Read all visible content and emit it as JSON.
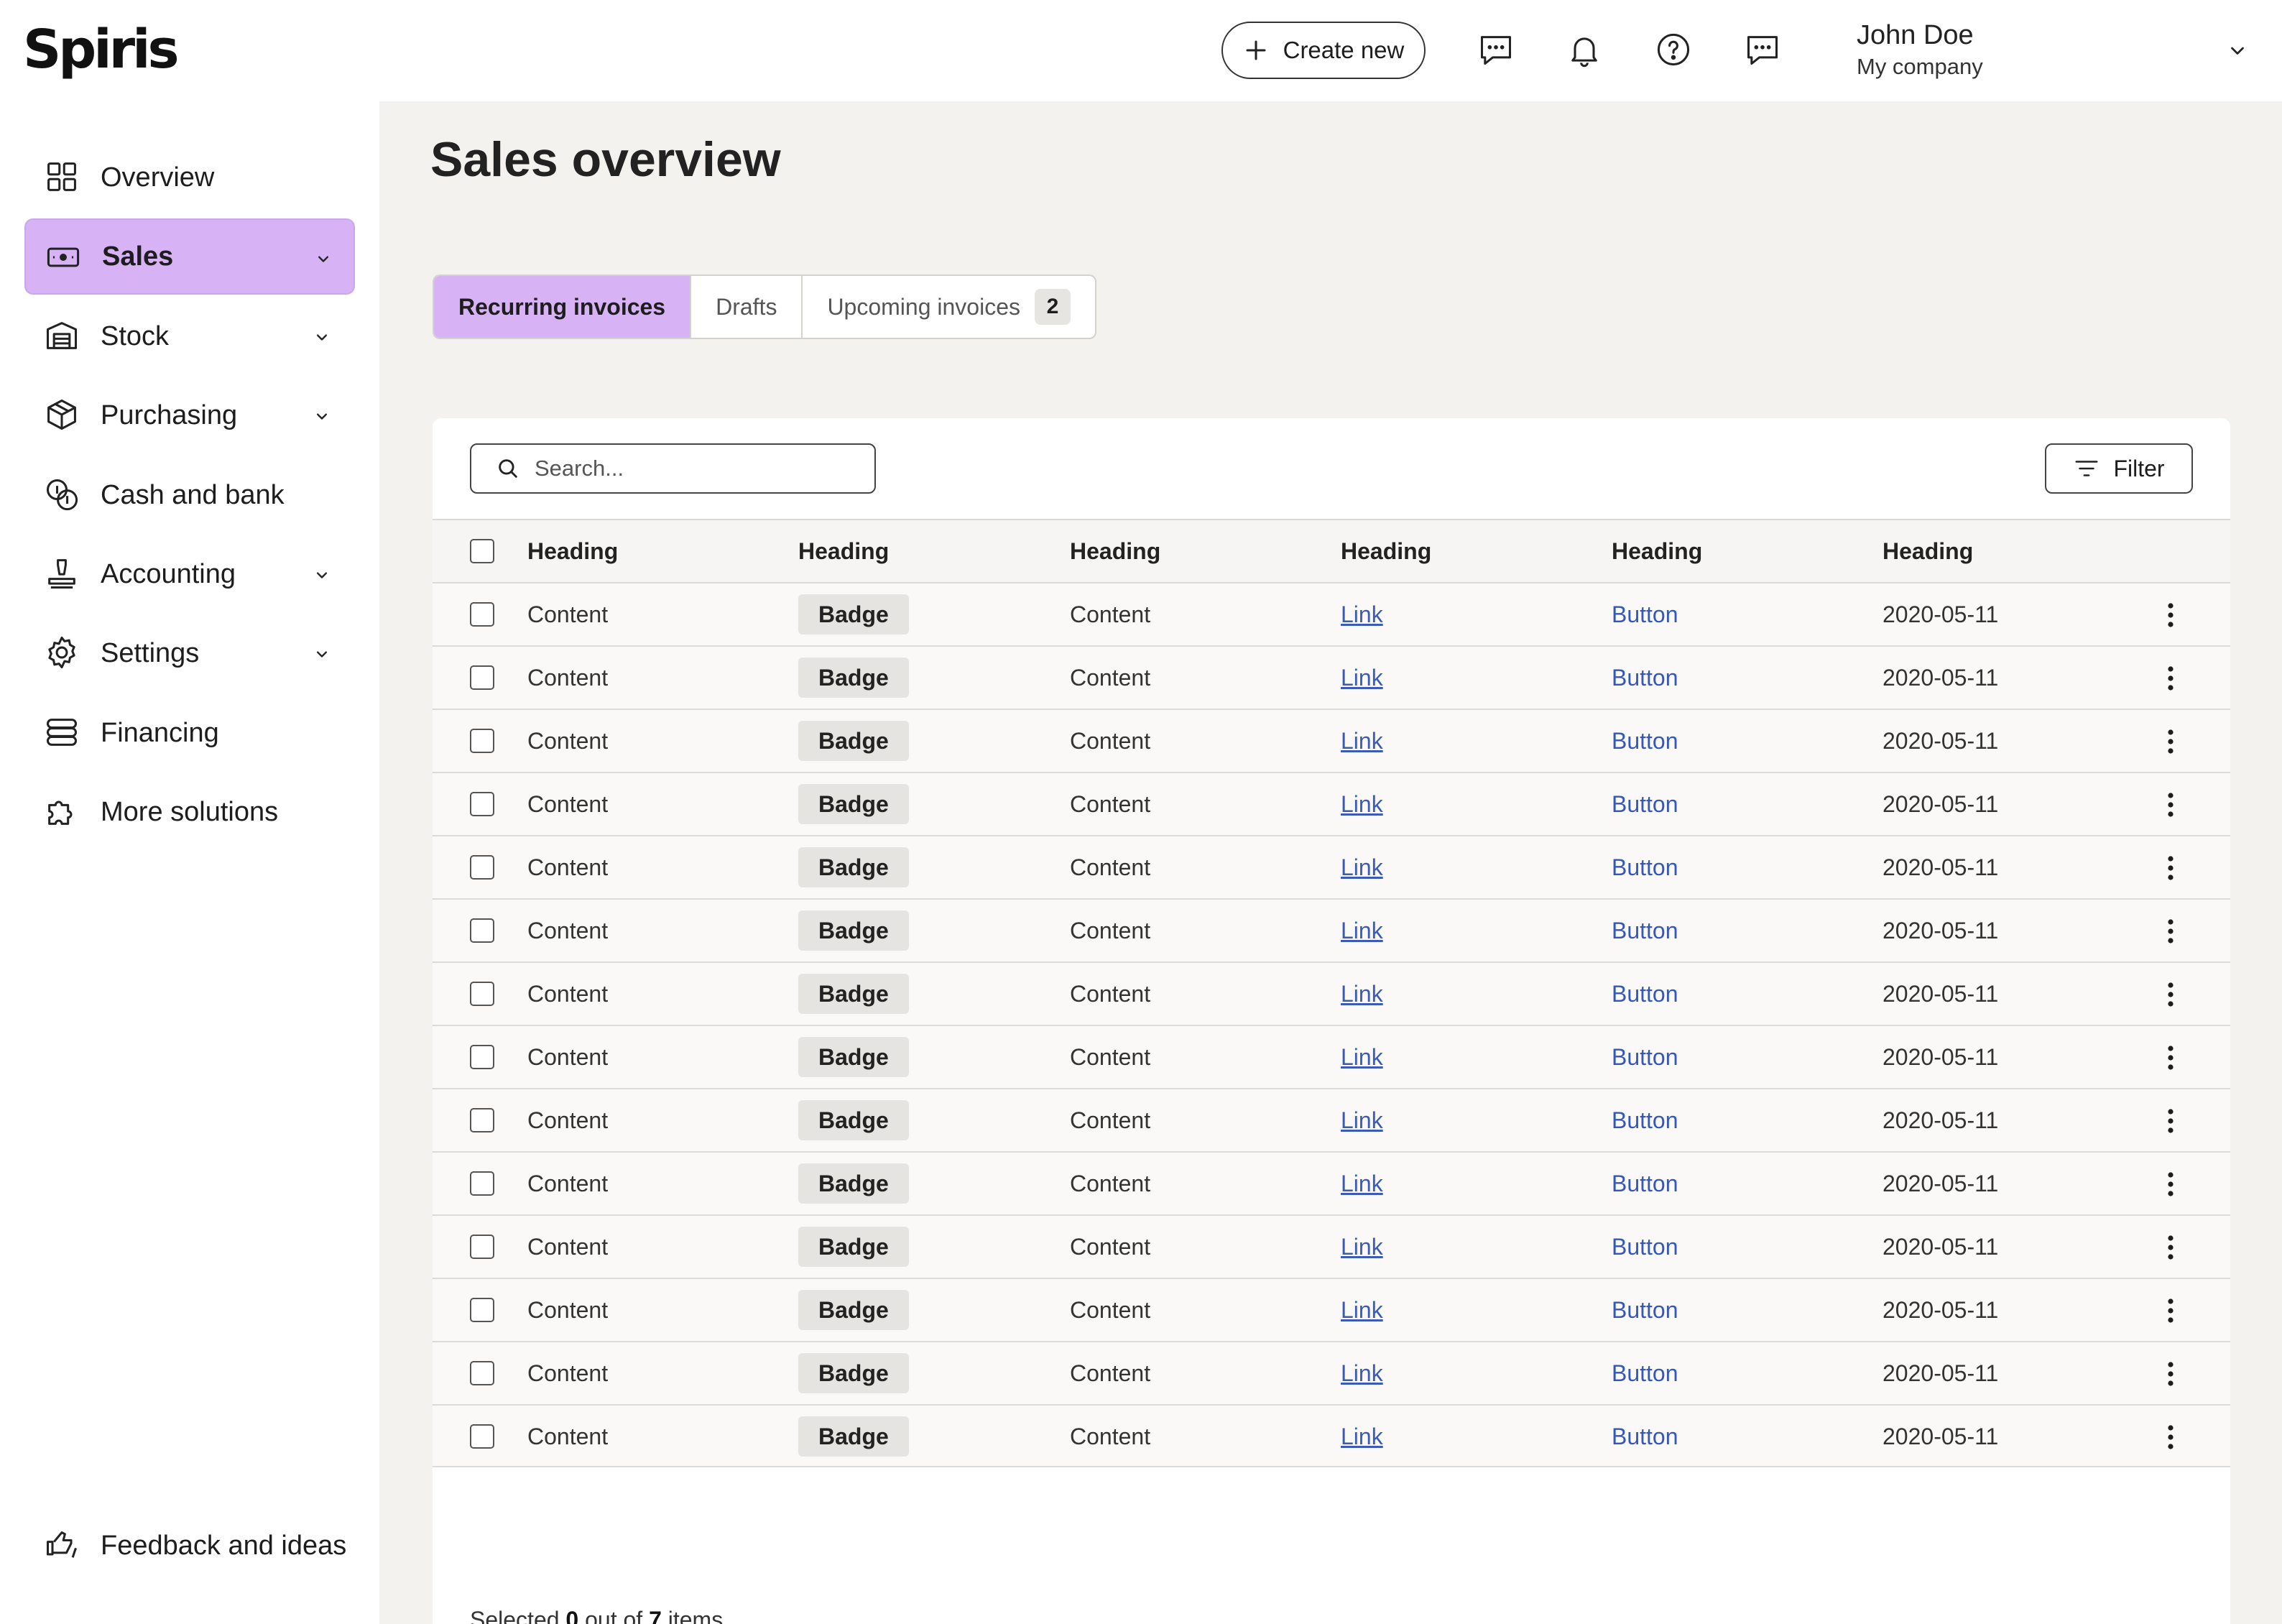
{
  "app": {
    "logo": "Spiris",
    "create_new_label": "Create new",
    "user": {
      "name": "John Doe",
      "company": "My company"
    },
    "top_icons": [
      "message-icon",
      "bell-icon",
      "help-icon",
      "chat-icon"
    ]
  },
  "sidebar": {
    "items": [
      {
        "label": "Overview",
        "icon": "grid-icon",
        "has_chevron": false,
        "active": false
      },
      {
        "label": "Sales",
        "icon": "cash-icon",
        "has_chevron": true,
        "active": true
      },
      {
        "label": "Stock",
        "icon": "warehouse-icon",
        "has_chevron": true,
        "active": false
      },
      {
        "label": "Purchasing",
        "icon": "box-icon",
        "has_chevron": true,
        "active": false
      },
      {
        "label": "Cash and bank",
        "icon": "coins-icon",
        "has_chevron": false,
        "active": false
      },
      {
        "label": "Accounting",
        "icon": "stamp-icon",
        "has_chevron": true,
        "active": false
      },
      {
        "label": "Settings",
        "icon": "gear-icon",
        "has_chevron": true,
        "active": false
      },
      {
        "label": "Financing",
        "icon": "stack-icon",
        "has_chevron": false,
        "active": false
      },
      {
        "label": "More solutions",
        "icon": "puzzle-icon",
        "has_chevron": false,
        "active": false
      }
    ],
    "feedback_label": "Feedback and ideas"
  },
  "main": {
    "title": "Sales overview",
    "tabs": [
      {
        "label": "Recurring invoices",
        "active": true
      },
      {
        "label": "Drafts",
        "active": false
      },
      {
        "label": "Upcoming invoices",
        "active": false,
        "count": "2"
      }
    ],
    "search_placeholder": "Search...",
    "filter_label": "Filter",
    "table": {
      "headers": [
        "Heading",
        "Heading",
        "Heading",
        "Heading",
        "Heading",
        "Heading"
      ],
      "rows": [
        [
          "Content",
          "Badge",
          "Content",
          "Link",
          "Button",
          "2020-05-11"
        ],
        [
          "Content",
          "Badge",
          "Content",
          "Link",
          "Button",
          "2020-05-11"
        ],
        [
          "Content",
          "Badge",
          "Content",
          "Link",
          "Button",
          "2020-05-11"
        ],
        [
          "Content",
          "Badge",
          "Content",
          "Link",
          "Button",
          "2020-05-11"
        ],
        [
          "Content",
          "Badge",
          "Content",
          "Link",
          "Button",
          "2020-05-11"
        ],
        [
          "Content",
          "Badge",
          "Content",
          "Link",
          "Button",
          "2020-05-11"
        ],
        [
          "Content",
          "Badge",
          "Content",
          "Link",
          "Button",
          "2020-05-11"
        ],
        [
          "Content",
          "Badge",
          "Content",
          "Link",
          "Button",
          "2020-05-11"
        ],
        [
          "Content",
          "Badge",
          "Content",
          "Link",
          "Button",
          "2020-05-11"
        ],
        [
          "Content",
          "Badge",
          "Content",
          "Link",
          "Button",
          "2020-05-11"
        ],
        [
          "Content",
          "Badge",
          "Content",
          "Link",
          "Button",
          "2020-05-11"
        ],
        [
          "Content",
          "Badge",
          "Content",
          "Link",
          "Button",
          "2020-05-11"
        ],
        [
          "Content",
          "Badge",
          "Content",
          "Link",
          "Button",
          "2020-05-11"
        ],
        [
          "Content",
          "Badge",
          "Content",
          "Link",
          "Button",
          "2020-05-11"
        ]
      ]
    },
    "footer": {
      "prefix": "Selected",
      "selected": "0",
      "middle": "out of",
      "total": "7",
      "suffix": "items"
    }
  },
  "colors": {
    "accent": "#d7b3f6",
    "link": "#3b5bb6",
    "main_bg": "#f3f2ef"
  }
}
